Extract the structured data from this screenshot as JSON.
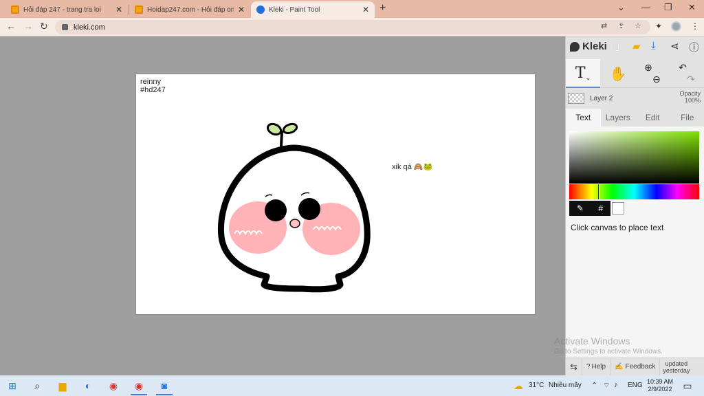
{
  "browser": {
    "tabs": [
      {
        "title": "Hỏi đáp 247 - trang tra loi"
      },
      {
        "title": "Hoidap247.com - Hỏi đáp online"
      },
      {
        "title": "Kleki - Paint Tool",
        "active": true
      }
    ],
    "url": "kleki.com"
  },
  "canvas": {
    "text_top_line1": "reinny",
    "text_top_line2": "#hd247",
    "text_side": "xik qá 🙈🐸"
  },
  "panel": {
    "logo": "Kleki",
    "layer_name": "Layer 2",
    "opacity_label": "Opacity",
    "opacity_value": "100%",
    "tabs": [
      "Text",
      "Layers",
      "Edit",
      "File"
    ],
    "active_tab": "Text",
    "hex_label": "#",
    "hint": "Click canvas to place text",
    "footer": {
      "help": "Help",
      "feedback": "Feedback",
      "updated_line1": "updated",
      "updated_line2": "yesterday"
    },
    "colors": {
      "primary": "#000000",
      "secondary": "#ffffff",
      "picker_hue": "#7ee000"
    }
  },
  "watermark": {
    "line1": "Activate Windows",
    "line2": "Go to Settings to activate Windows."
  },
  "taskbar": {
    "weather_temp": "31°C",
    "weather_text": "Nhiều mây",
    "lang": "ENG",
    "time": "10:39 AM",
    "date": "2/9/2022"
  }
}
